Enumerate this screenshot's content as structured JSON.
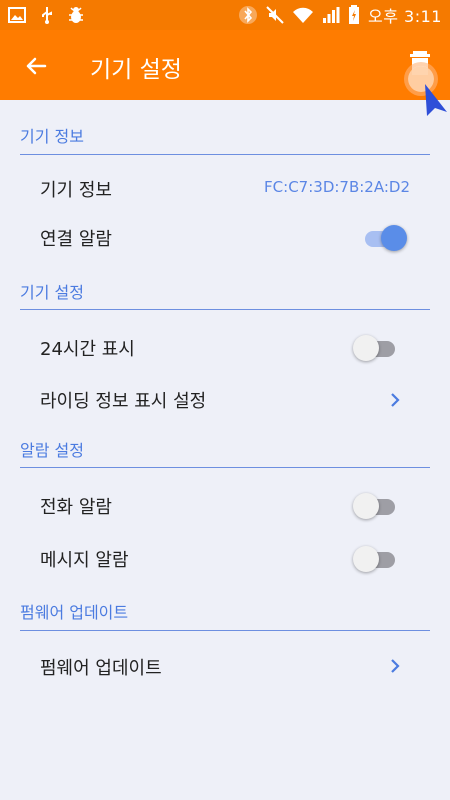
{
  "status_bar": {
    "time": "오후 3:11",
    "left_icons": [
      "image-icon",
      "usb-icon",
      "bug-icon"
    ],
    "right_icons": [
      "bluetooth-icon",
      "mute-icon",
      "wifi-icon",
      "signal-icon",
      "battery-icon"
    ]
  },
  "app_bar": {
    "title": "기기 설정",
    "back_icon": "back-arrow-icon",
    "delete_icon": "trash-icon",
    "background": "#ff7c00"
  },
  "colors": {
    "accent": "#5a8de8",
    "section": "#4b7be0",
    "divider": "#6d8fe0"
  },
  "sections": [
    {
      "header": "기기 정보",
      "rows": [
        {
          "label": "기기 정보",
          "value": "FC:C7:3D:7B:2A:D2"
        },
        {
          "label": "연결 알람",
          "toggle": true
        }
      ]
    },
    {
      "header": "기기 설정",
      "rows": [
        {
          "label": "24시간 표시",
          "toggle": false
        },
        {
          "label": "라이딩 정보 표시 설정",
          "chevron": true
        }
      ]
    },
    {
      "header": "알람 설정",
      "rows": [
        {
          "label": "전화 알람",
          "toggle": false
        },
        {
          "label": "메시지 알람",
          "toggle": false
        }
      ]
    },
    {
      "header": "펌웨어 업데이트",
      "rows": [
        {
          "label": "펌웨어 업데이트",
          "chevron": true
        }
      ]
    }
  ]
}
